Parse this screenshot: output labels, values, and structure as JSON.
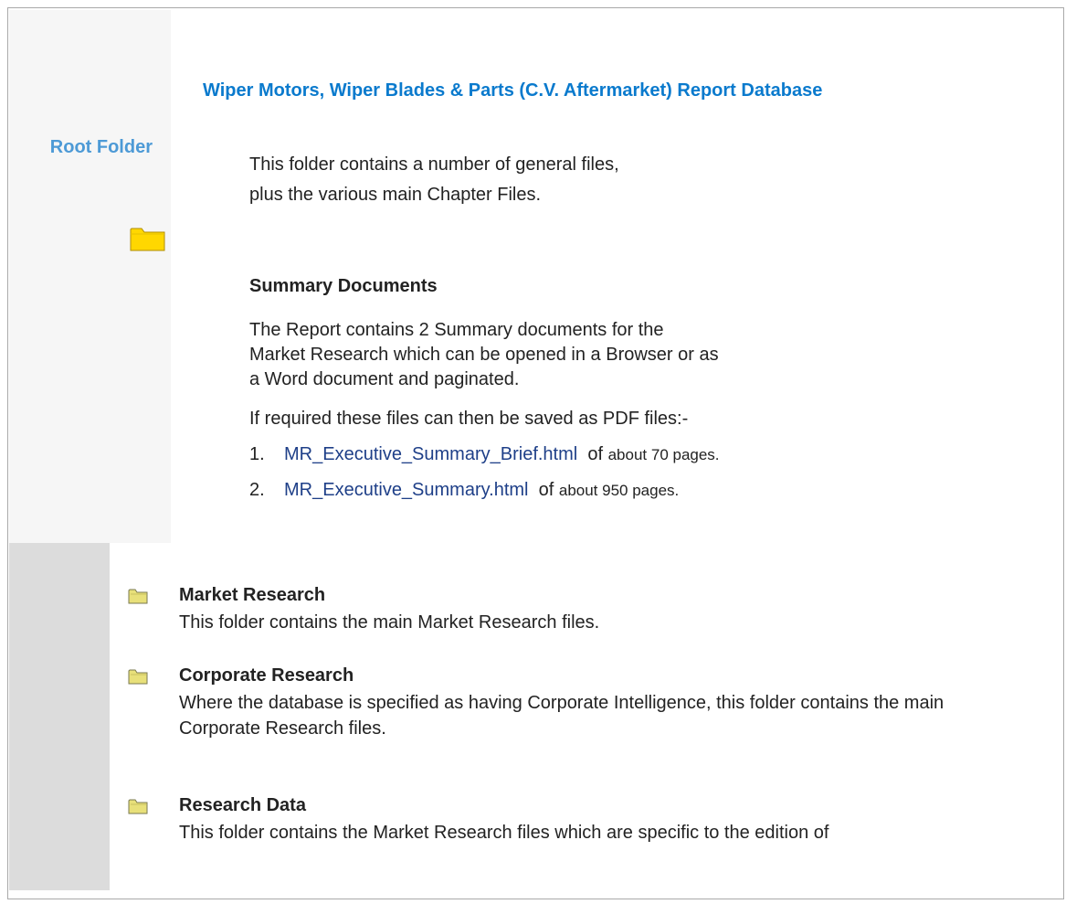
{
  "sidebar": {
    "label": "Root Folder"
  },
  "header": {
    "title": "Wiper Motors, Wiper Blades & Parts (C.V. Aftermarket) Report Database"
  },
  "intro": "This folder contains a number of general files, plus the various main Chapter Files.",
  "summary": {
    "title": "Summary Documents",
    "body": "The Report contains 2 Summary documents for the Market Research which can be opened in a Browser or as a Word document and paginated.",
    "pdf_note": "If required these files can then be saved as PDF files:-",
    "files": [
      {
        "num": "1.",
        "name": "MR_Executive_Summary_Brief.html",
        "of": "of",
        "pages": "about 70 pages."
      },
      {
        "num": "2.",
        "name": "MR_Executive_Summary.html",
        "of": "of",
        "pages": "about 950 pages."
      }
    ]
  },
  "folders": [
    {
      "title": "Market Research",
      "desc": "This folder contains the main Market Research files."
    },
    {
      "title": "Corporate Research",
      "desc": "Where the database is specified as having Corporate Intelligence, this folder contains the main Corporate Research files."
    },
    {
      "title": "Research Data",
      "desc": "This folder contains the Market Research files which are specific to the edition of"
    }
  ],
  "icons": {
    "root_folder": "folder-icon",
    "sub_folder": "folder-icon"
  },
  "colors": {
    "heading": "#0a7acd",
    "root_label": "#4d9ad6",
    "link": "#1e3f88",
    "folder_yellow": "#ffd700"
  }
}
